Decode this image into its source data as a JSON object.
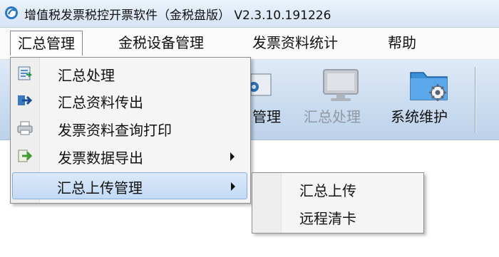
{
  "window": {
    "title": "增值税发票税控开票软件（金税盘版） V2.3.10.191226",
    "logo_icon": "app-logo-icon"
  },
  "menubar": {
    "items": [
      {
        "label": "汇总管理",
        "active": true
      },
      {
        "label": "金税设备管理",
        "active": false
      },
      {
        "label": "发票资料统计",
        "active": false
      },
      {
        "label": "帮助",
        "active": false
      }
    ]
  },
  "toolbar": {
    "items": [
      {
        "label": "管理",
        "icon": "management-icon",
        "enabled": true
      },
      {
        "label": "汇总处理",
        "icon": "monitor-icon",
        "enabled": false
      },
      {
        "label": "系统维护",
        "icon": "folder-gear-icon",
        "enabled": true
      }
    ]
  },
  "dropdown": {
    "items": [
      {
        "label": "汇总处理",
        "icon": "summary-process-icon",
        "has_submenu": false,
        "highlighted": false
      },
      {
        "label": "汇总资料传出",
        "icon": "export-arrow-icon",
        "has_submenu": false,
        "highlighted": false
      },
      {
        "label": "发票资料查询打印",
        "icon": "printer-icon",
        "has_submenu": false,
        "highlighted": false
      },
      {
        "label": "发票数据导出",
        "icon": "data-export-icon",
        "has_submenu": true,
        "highlighted": false
      },
      {
        "label": "汇总上传管理",
        "icon": "",
        "has_submenu": true,
        "highlighted": true
      }
    ]
  },
  "submenu": {
    "items": [
      {
        "label": "汇总上传"
      },
      {
        "label": "远程清卡"
      }
    ]
  },
  "colors": {
    "menu_highlight": "#c3daf5",
    "toolbar_bg": "#c9dbef",
    "disabled_text": "#8f98a3"
  }
}
